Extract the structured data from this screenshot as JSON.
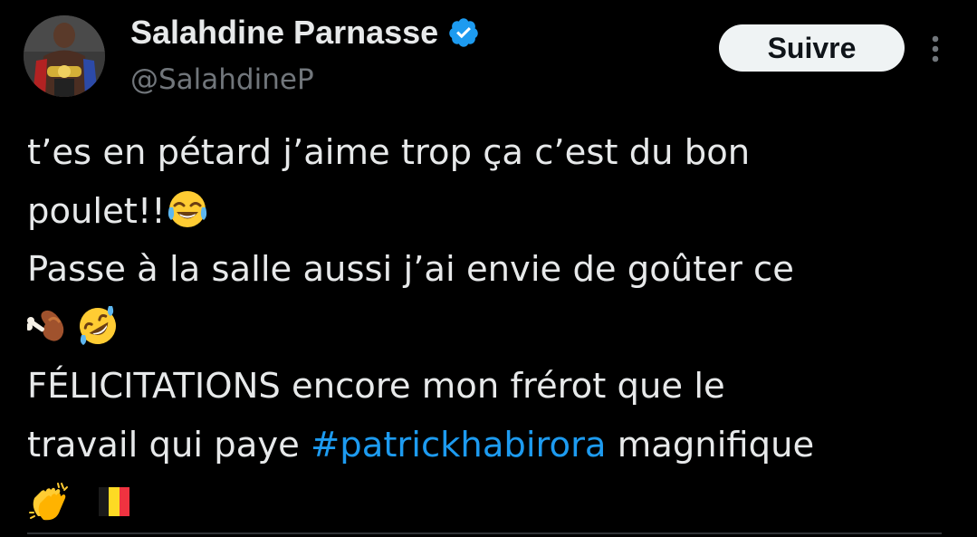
{
  "author": {
    "display_name": "Salahdine Parnasse",
    "handle": "@SalahdineP",
    "verified": true
  },
  "actions": {
    "follow_label": "Suivre",
    "more_icon": "more-vertical-icon"
  },
  "tweet": {
    "line1": "t’es en pétard j’aime trop ça c’est du bon",
    "line2": "poulet!!",
    "line2_emoji": "face-with-tears-of-joy",
    "line3": "Passe à la salle aussi j’ai envie de goûter ce",
    "line4_emojis": [
      "poultry-leg",
      "rolling-on-the-floor-laughing"
    ],
    "line5": "FÉLICITATIONS encore mon frérot que le",
    "line6_before": "travail qui paye ",
    "hashtag": "#patrickhabirora",
    "line6_after": " magnifique",
    "line7_emojis": [
      "clapping-hands",
      "flag-belgium"
    ]
  },
  "colors": {
    "background": "#000000",
    "text": "#e7e9ea",
    "secondary": "#71767b",
    "link": "#1d9bf0",
    "verified": "#1d9bf0",
    "button_bg": "#eff3f4"
  }
}
